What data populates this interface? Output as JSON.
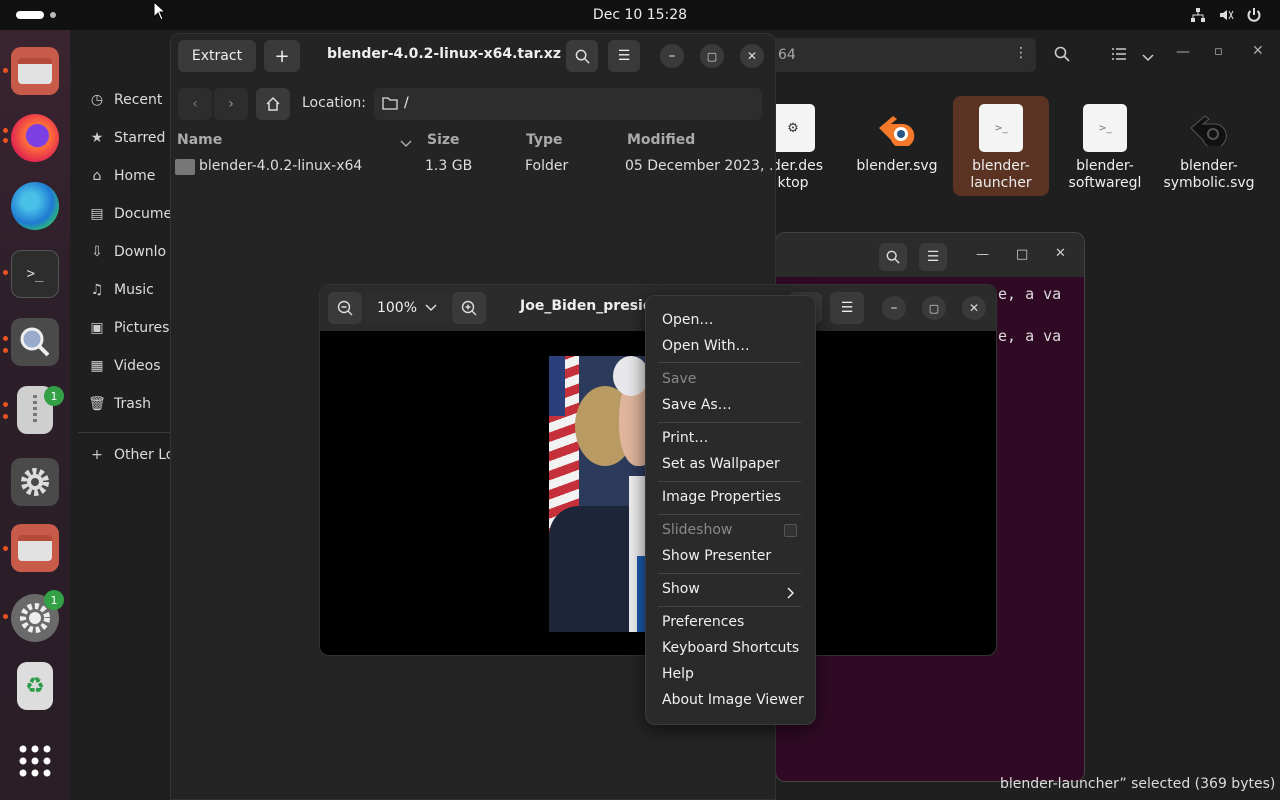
{
  "topbar": {
    "clock": "Dec 10  15:28"
  },
  "dock": {
    "badges": {
      "archive": "1",
      "updater": "1"
    }
  },
  "bg_files": {
    "sidebar": [
      {
        "label": "Recent",
        "icon": "clock-icon"
      },
      {
        "label": "Starred",
        "icon": "star-icon"
      },
      {
        "label": "Home",
        "icon": "home-icon"
      },
      {
        "label": "Docume",
        "icon": "document-icon"
      },
      {
        "label": "Downlo",
        "icon": "download-icon"
      },
      {
        "label": "Music",
        "icon": "music-icon"
      },
      {
        "label": "Pictures",
        "icon": "picture-icon"
      },
      {
        "label": "Videos",
        "icon": "video-icon"
      },
      {
        "label": "Trash",
        "icon": "trash-icon"
      }
    ],
    "other_locations": "Other Lo",
    "path_fragment": "64",
    "files": [
      {
        "name": "nder.des\nktop"
      },
      {
        "name": "blender.svg"
      },
      {
        "name": "blender-\nlauncher"
      },
      {
        "name": "blender-\nsoftwaregl"
      },
      {
        "name": "blender-\nsymbolic.svg"
      }
    ],
    "status": "blender-launcher” selected  (369 bytes)"
  },
  "archive": {
    "extract_label": "Extract",
    "add_label": "+",
    "title": "blender-4.0.2-linux-x64.tar.xz",
    "location_label": "Location:",
    "location_value": "/",
    "columns": {
      "name": "Name",
      "size": "Size",
      "type": "Type",
      "modified": "Modified"
    },
    "rows": [
      {
        "name": "blender-4.0.2-linux-x64",
        "size": "1.3 GB",
        "type": "Folder",
        "modified": "05 December 2023, …"
      }
    ]
  },
  "terminal": {
    "lines": [
      "e, a va",
      "e, a va"
    ]
  },
  "viewer": {
    "zoom": "100%",
    "title": "Joe_Biden_preside"
  },
  "menu": {
    "open": "Open…",
    "open_with": "Open With…",
    "save": "Save",
    "save_as": "Save As…",
    "print": "Print…",
    "set_wallpaper": "Set as Wallpaper",
    "image_properties": "Image Properties",
    "slideshow": "Slideshow",
    "show_presenter": "Show Presenter",
    "show": "Show",
    "preferences": "Preferences",
    "keyboard_shortcuts": "Keyboard Shortcuts",
    "help": "Help",
    "about": "About Image Viewer"
  },
  "colors": {
    "accent": "#e95420",
    "terminal_bg": "#300a24",
    "badge": "#33a046"
  }
}
